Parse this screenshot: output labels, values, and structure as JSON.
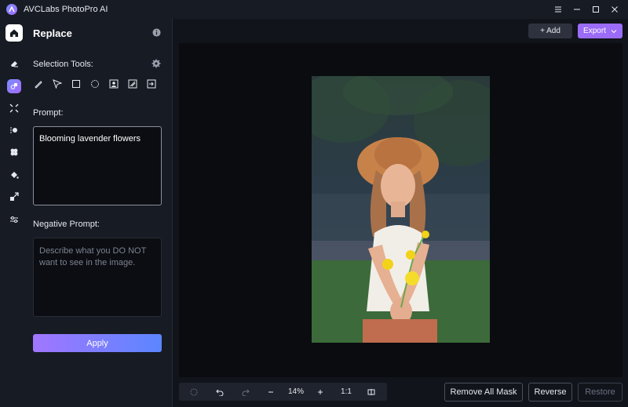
{
  "app": {
    "title": "AVCLabs PhotoPro AI"
  },
  "rail": {
    "items": [
      "home-icon",
      "eraser-icon",
      "replace-icon",
      "upscale-icon",
      "background-icon",
      "colorize-icon",
      "fill-icon",
      "crop-icon",
      "adjust-icon"
    ],
    "active": "replace-icon"
  },
  "panel": {
    "title": "Replace",
    "selection_tools_label": "Selection Tools:",
    "tools": [
      "brush-icon",
      "lasso-icon",
      "rectangle-select-icon",
      "ellipse-select-icon",
      "subject-select-icon",
      "auto-select-icon",
      "import-mask-icon"
    ],
    "prompt_label": "Prompt:",
    "prompt_value": "Blooming lavender flowers",
    "negative_label": "Negative Prompt:",
    "negative_placeholder": "Describe what you DO NOT want to see in the image.",
    "apply_label": "Apply"
  },
  "toolbar": {
    "add_label": "+ Add",
    "export_label": "Export"
  },
  "zoom": {
    "value": "14%",
    "ratio": "1:1"
  },
  "actions": {
    "remove_all_mask": "Remove All Mask",
    "reverse": "Reverse",
    "restore": "Restore"
  },
  "colors": {
    "accent": "#9b6cf7",
    "apply_start": "#a176ff",
    "apply_end": "#5b86ff",
    "bg": "#11141b"
  }
}
